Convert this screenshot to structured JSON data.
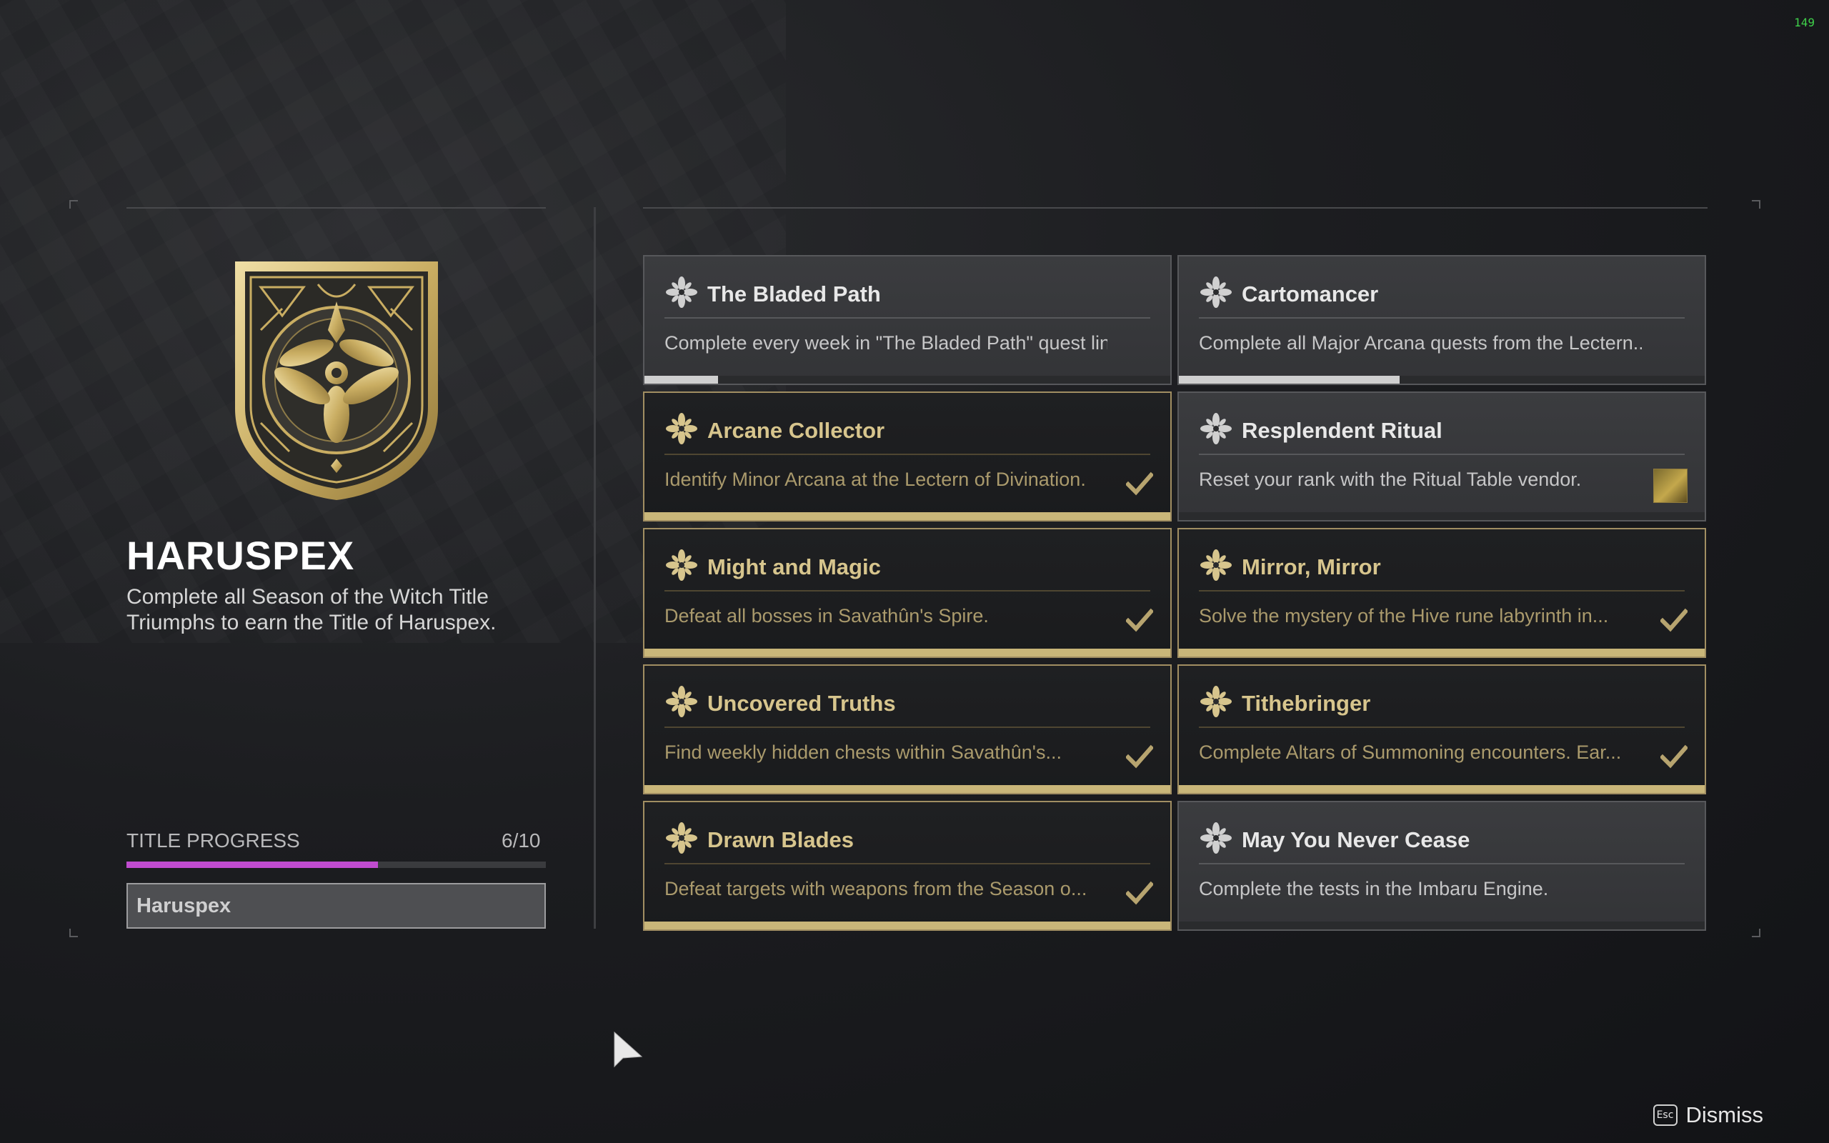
{
  "fps_counter": "149",
  "seal": {
    "name": "HARUSPEX",
    "description": "Complete all Season of the Witch Title Triumphs to earn the Title of Haruspex.",
    "emblem_icon": "haruspex-seal-emblem"
  },
  "progress": {
    "label": "TITLE PROGRESS",
    "count": "6/10",
    "fraction": 0.6,
    "bar_color": "#c04ccf"
  },
  "title_box": {
    "label": "Haruspex"
  },
  "triumphs": [
    {
      "name": "The Bladed Path",
      "description": "Complete every week in \"The Bladed Path\" quest line.",
      "completed": false,
      "progress": 0.14,
      "icon": "triumph-flower-icon"
    },
    {
      "name": "Cartomancer",
      "description": "Complete all Major Arcana quests from the Lectern...",
      "completed": false,
      "progress": 0.42,
      "icon": "triumph-flower-icon"
    },
    {
      "name": "Arcane Collector",
      "description": "Identify Minor Arcana at the Lectern of Divination.",
      "completed": true,
      "progress": 1.0,
      "icon": "triumph-flower-icon"
    },
    {
      "name": "Resplendent Ritual",
      "description": "Reset your rank with the Ritual Table vendor.",
      "completed": false,
      "progress": 0,
      "icon": "triumph-flower-icon",
      "side_icon": "ritual-vendor-icon"
    },
    {
      "name": "Might and Magic",
      "description": "Defeat all bosses in Savathûn's Spire.",
      "completed": true,
      "progress": 1.0,
      "icon": "triumph-flower-icon"
    },
    {
      "name": "Mirror, Mirror",
      "description": "Solve the mystery of the Hive rune labyrinth in...",
      "completed": true,
      "progress": 1.0,
      "icon": "triumph-flower-icon"
    },
    {
      "name": "Uncovered Truths",
      "description": "Find weekly hidden chests within Savathûn's...",
      "completed": true,
      "progress": 1.0,
      "icon": "triumph-flower-icon"
    },
    {
      "name": "Tithebringer",
      "description": "Complete Altars of Summoning encounters. Ear...",
      "completed": true,
      "progress": 1.0,
      "icon": "triumph-flower-icon"
    },
    {
      "name": "Drawn Blades",
      "description": "Defeat targets with weapons from the Season o...",
      "completed": true,
      "progress": 1.0,
      "icon": "triumph-flower-icon"
    },
    {
      "name": "May You Never Cease",
      "description": "Complete the tests in the Imbaru Engine.",
      "completed": false,
      "progress": 0,
      "icon": "triumph-flower-icon"
    }
  ],
  "footer": {
    "key_label": "Esc",
    "dismiss_label": "Dismiss"
  },
  "colors": {
    "gold_accent": "#d7c58d",
    "complete_border": "#a18e62",
    "incomplete_bg": "#3b3c3f"
  }
}
